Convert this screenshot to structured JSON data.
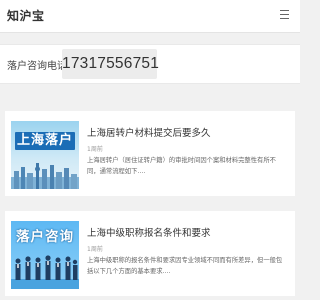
{
  "header": {
    "logo_text": "知沪宝",
    "menu_icon": "hamburger-menu-icon"
  },
  "contact": {
    "label": "落户咨询电话:",
    "phone": "17317556751"
  },
  "articles": [
    {
      "thumbnail_text": "上海落户",
      "title": "上海居转户材料提交后要多久",
      "time": "1周前",
      "summary": "上海居转户（居住证转户籍）的审批时间因个案和材料完整性有所不同，通常流程如下...."
    },
    {
      "thumbnail_text": "落户咨询",
      "title": "上海中级职称报名条件和要求",
      "time": "1周前",
      "summary": "上海中级职称的报名条件和要求因专业领域不同而有所差异，但一般包括以下几个方面的基本要求...."
    }
  ],
  "colors": {
    "background": "#f1f1f1",
    "banner_blue": "#1b6db6",
    "thumb_sky": "#5db8f3"
  }
}
